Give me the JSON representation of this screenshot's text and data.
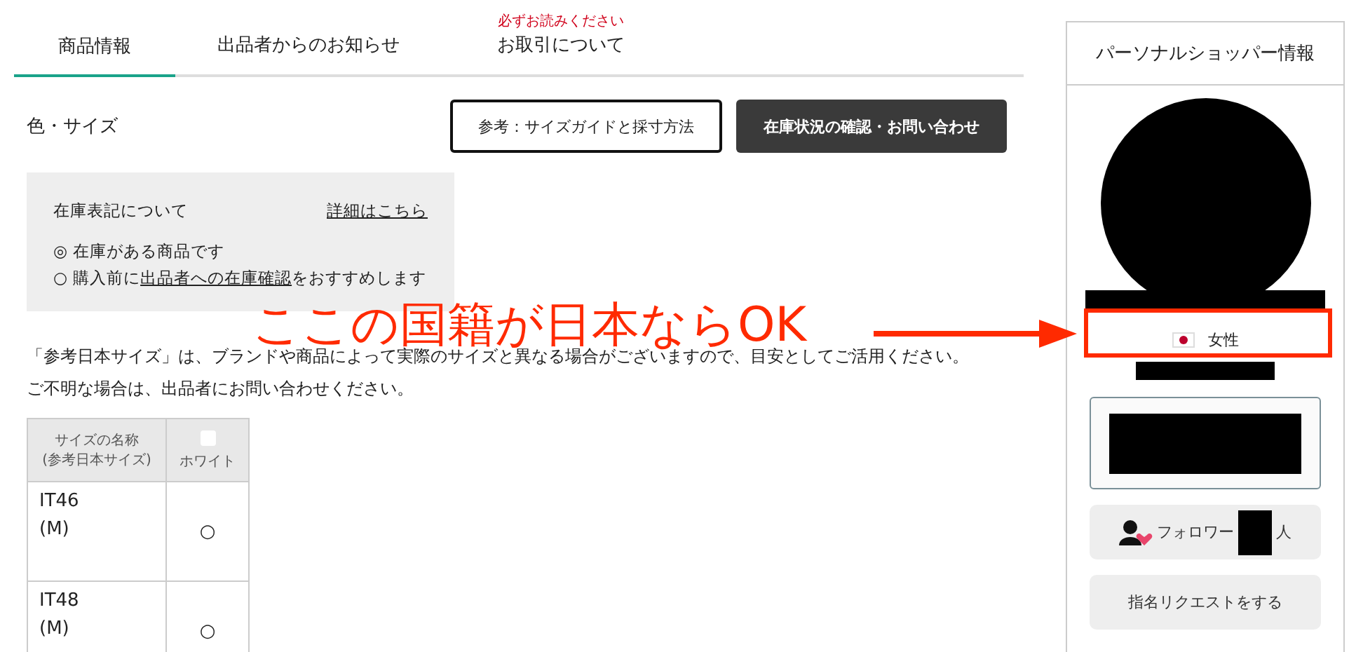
{
  "tabs": [
    {
      "label": "商品情報",
      "selected": true
    },
    {
      "label": "出品者からのお知らせ",
      "selected": false
    },
    {
      "label": "お取引について",
      "selected": false,
      "note": "必ずお読みください"
    }
  ],
  "section": {
    "title": "色・サイズ",
    "buttons": [
      {
        "label": "参考：サイズガイドと採寸方法",
        "kind": "outline"
      },
      {
        "label": "在庫状況の確認・お問い合わせ",
        "kind": "dark"
      }
    ]
  },
  "stock_notice": {
    "title": "在庫表記について",
    "link": "詳細はこちら",
    "lines": [
      {
        "symbol": "◎",
        "text": "在庫がある商品です"
      },
      {
        "symbol": "○",
        "text": "購入前に",
        "link": "出品者への在庫確認",
        "after": "をおすすめします"
      }
    ]
  },
  "notes": [
    "「参考日本サイズ」は、ブランドや商品によって実際のサイズと異なる場合がございますので、目安としてご活用ください。",
    "ご不明な場合は、出品者にお問い合わせください。"
  ],
  "size_table": {
    "columns": [
      {
        "lines": [
          "サイズの名称",
          "(参考日本サイズ)"
        ]
      },
      {
        "lines": [
          "ホワイト"
        ],
        "swatch": true
      }
    ],
    "rows": [
      {
        "lines": [
          "IT46",
          "(M)"
        ],
        "stock": "○"
      },
      {
        "lines": [
          "IT48",
          "(M)"
        ],
        "stock": "○"
      }
    ]
  },
  "shopper": {
    "title": "パーソナルショッパー情報",
    "gender": "女性",
    "followers_label": "フォロワー",
    "followers_unit": "人",
    "request_button": "指名リクエストをする"
  },
  "annotation": {
    "text": "ここの国籍が日本ならOK"
  }
}
